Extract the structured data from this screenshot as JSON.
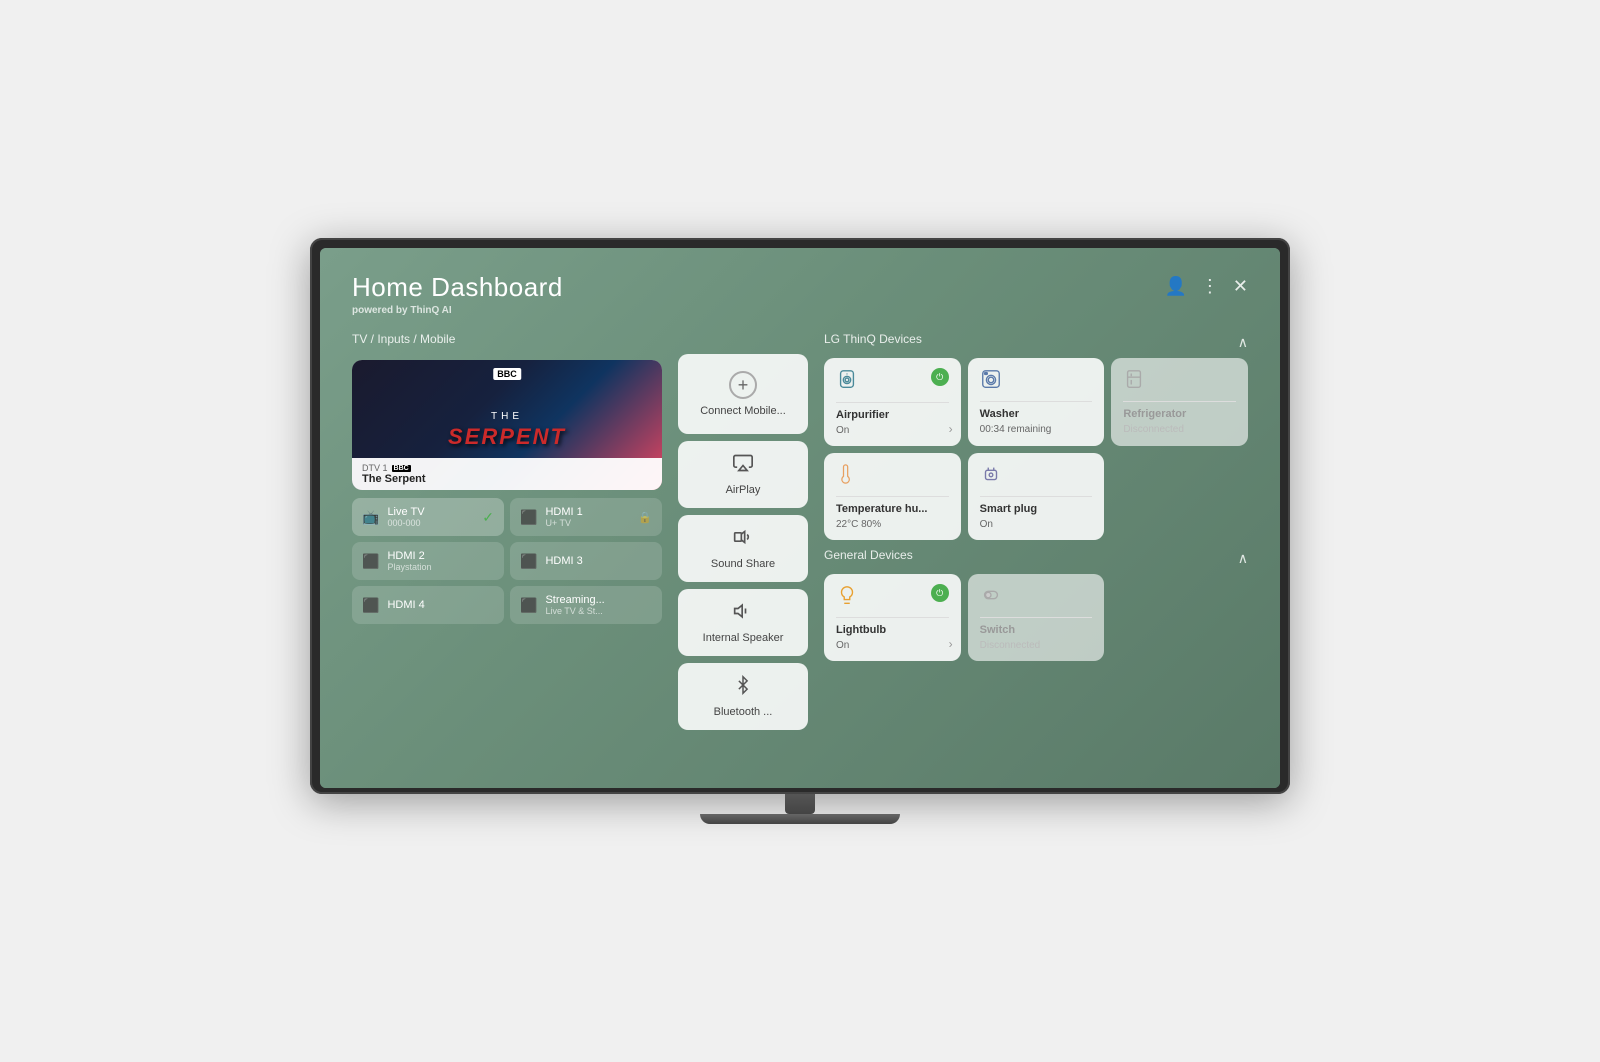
{
  "header": {
    "title": "Home Dashboard",
    "subtitle": "powered by",
    "subtitle_brand": "ThinQ AI"
  },
  "tv_section": {
    "label": "TV / Inputs / Mobile",
    "channel": "DTV 1",
    "show_name": "The Serpent",
    "show_title_line1": "The",
    "show_title_line2": "Serpent"
  },
  "inputs": [
    {
      "name": "Live TV",
      "sub": "000-000",
      "active": true,
      "check": true
    },
    {
      "name": "HDMI 1",
      "sub": "U+ TV",
      "active": false,
      "lock": true
    },
    {
      "name": "HDMI 2",
      "sub": "Playstation",
      "active": false
    },
    {
      "name": "HDMI 3",
      "sub": "",
      "active": false
    },
    {
      "name": "HDMI 4",
      "sub": "",
      "active": false
    },
    {
      "name": "Streaming...",
      "sub": "Live TV & St...",
      "active": false
    }
  ],
  "actions": [
    {
      "id": "connect",
      "label": "Connect Mobile...",
      "icon": "+"
    },
    {
      "id": "airplay",
      "label": "AirPlay",
      "icon": "▷"
    },
    {
      "id": "soundshare",
      "label": "Sound Share",
      "icon": "♪"
    },
    {
      "id": "speaker",
      "label": "Internal Speaker",
      "icon": "♩"
    },
    {
      "id": "bluetooth",
      "label": "Bluetooth ...",
      "icon": "⬡"
    }
  ],
  "thinq_section": {
    "label": "LG ThinQ Devices",
    "devices": [
      {
        "id": "airpurifier",
        "name": "Airpurifier",
        "status": "On",
        "icon": "💨",
        "power": true,
        "disconnected": false,
        "has_chevron": true
      },
      {
        "id": "washer",
        "name": "Washer",
        "status": "00:34 remaining",
        "icon": "🫧",
        "power": false,
        "disconnected": false,
        "has_chevron": false
      },
      {
        "id": "refrigerator",
        "name": "Refrigerator",
        "status": "Disconnected",
        "icon": "🧊",
        "power": false,
        "disconnected": true,
        "has_chevron": false
      },
      {
        "id": "temperature",
        "name": "Temperature hu...",
        "status": "22°C 80%",
        "icon": "🌡️",
        "power": false,
        "disconnected": false,
        "has_chevron": false
      },
      {
        "id": "smartplug",
        "name": "Smart plug",
        "status": "On",
        "icon": "🔌",
        "power": false,
        "disconnected": false,
        "has_chevron": false
      }
    ]
  },
  "general_section": {
    "label": "General Devices",
    "devices": [
      {
        "id": "lightbulb",
        "name": "Lightbulb",
        "status": "On",
        "icon": "💡",
        "power": true,
        "disconnected": false,
        "has_chevron": true
      },
      {
        "id": "switch",
        "name": "Switch",
        "status": "Disconnected",
        "icon": "🔒",
        "power": false,
        "disconnected": true,
        "has_chevron": false
      }
    ]
  },
  "icons": {
    "user": "👤",
    "menu": "⋮",
    "close": "✕",
    "chevron_up": "∧",
    "chevron_right": "›",
    "check": "✓",
    "power_symbol": "⏻"
  }
}
